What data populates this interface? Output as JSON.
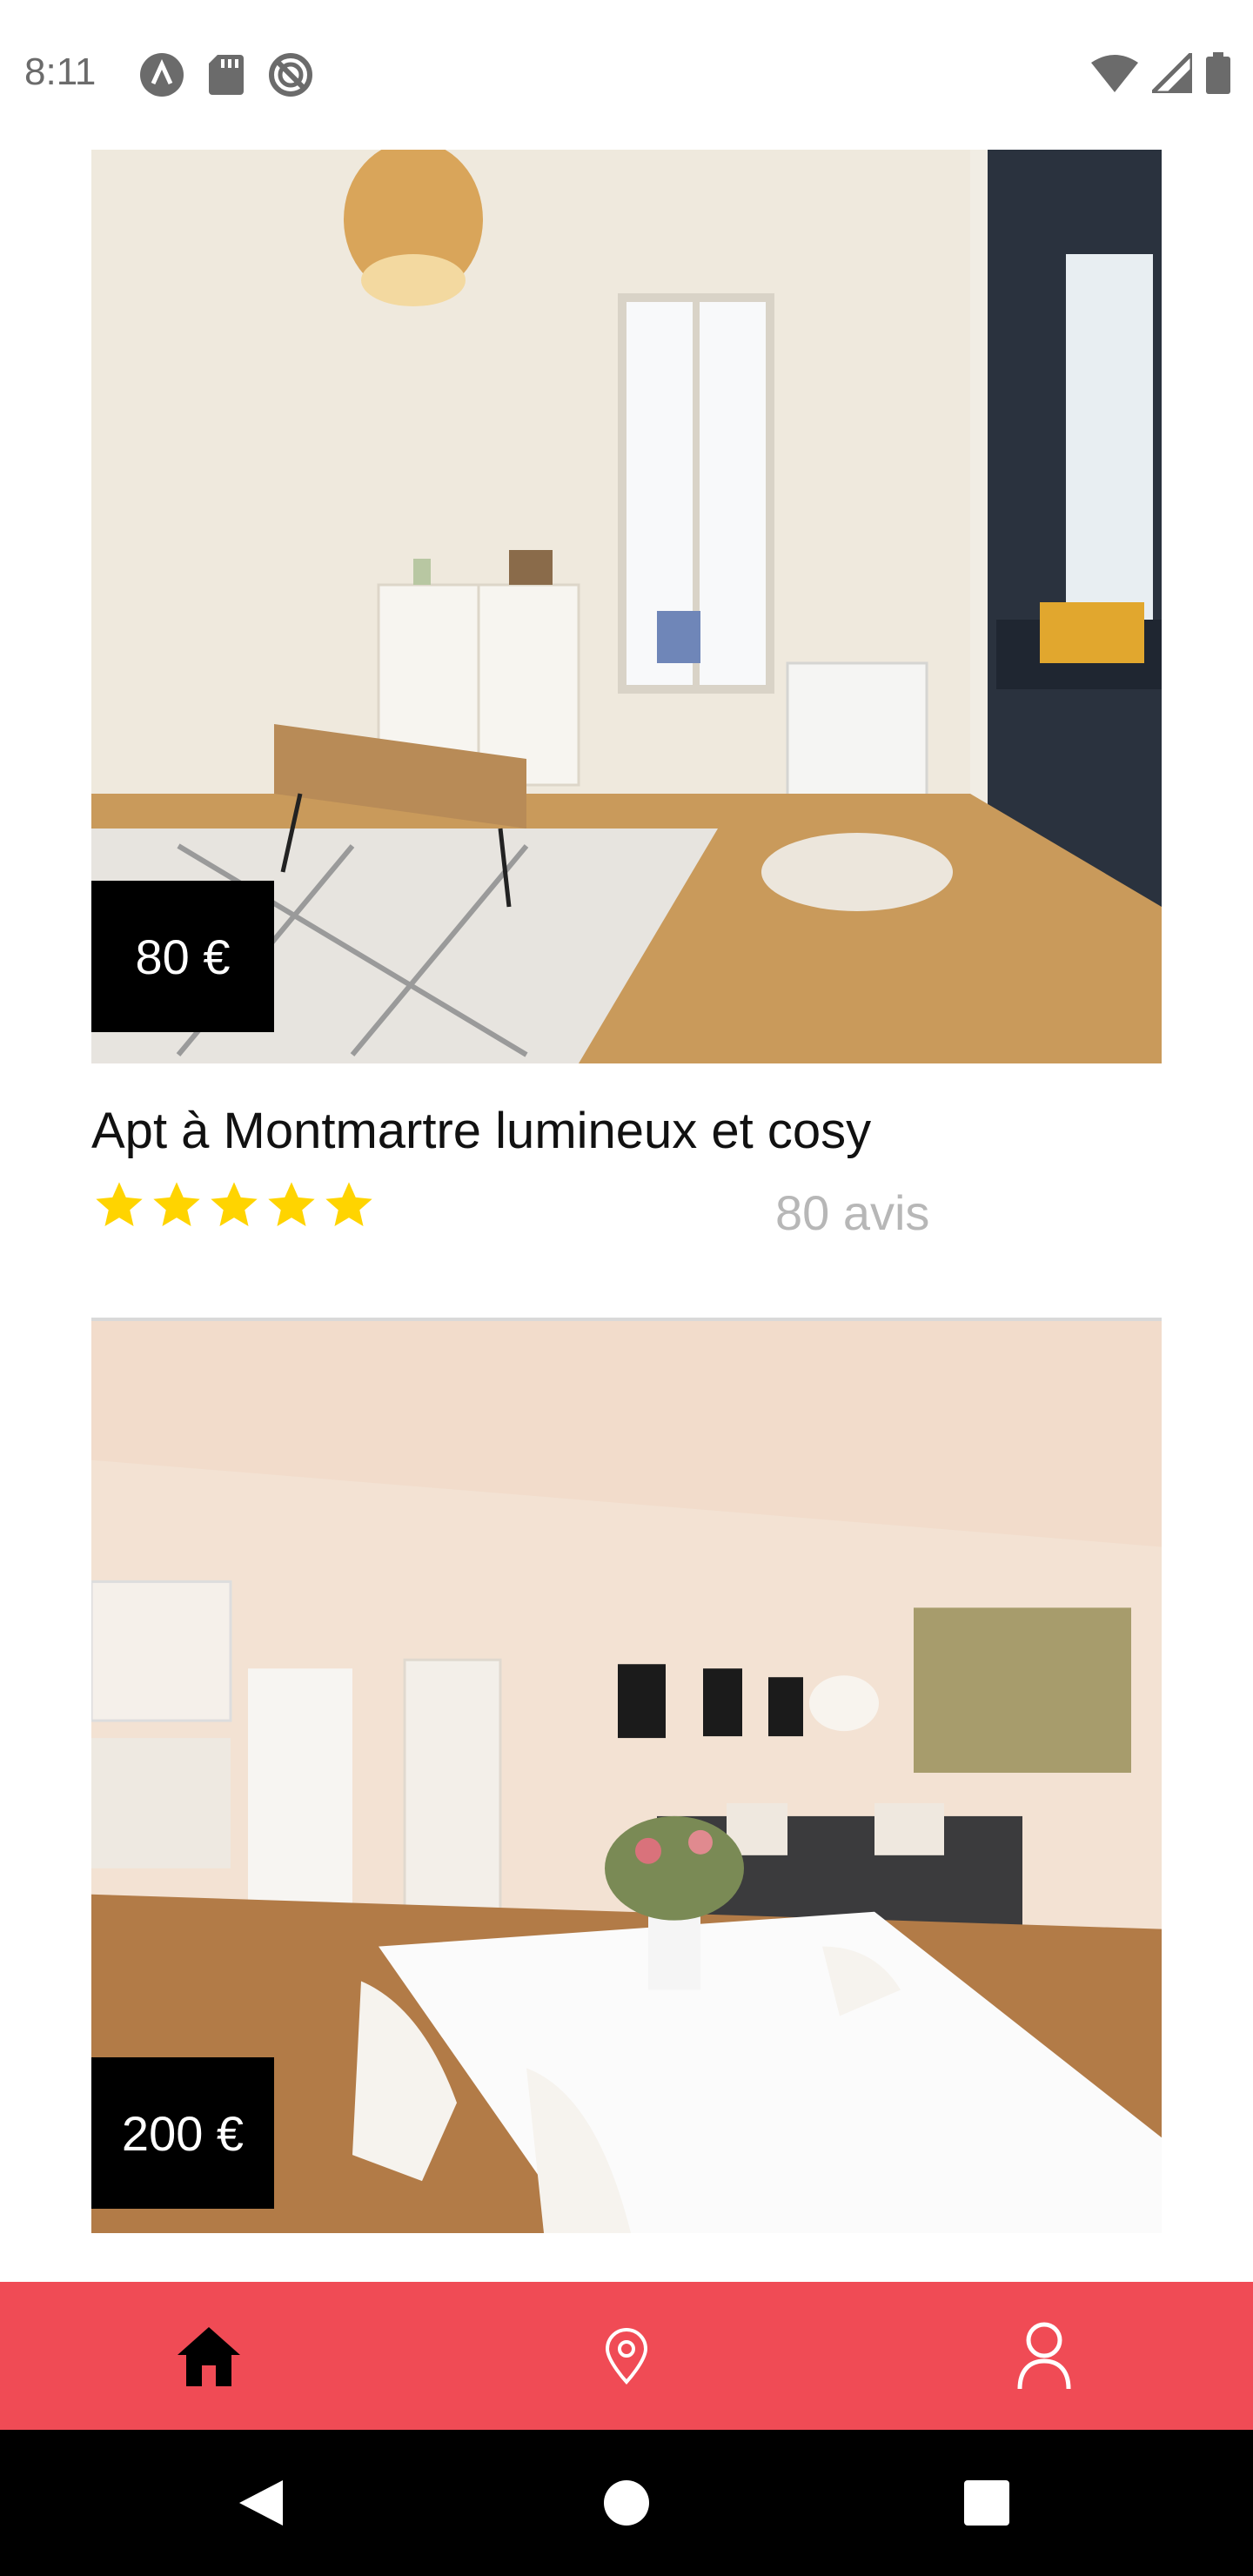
{
  "status_bar": {
    "time": "8:11",
    "left_icons": [
      "notification-a-icon",
      "sd-card-icon",
      "do-not-disturb-icon"
    ],
    "right_icons": [
      "wifi-icon",
      "cell-signal-icon",
      "battery-icon"
    ]
  },
  "listings": [
    {
      "price": "80 €",
      "title": "Apt à Montmartre lumineux et cosy",
      "rating": 5,
      "reviews": "80 avis",
      "image": "living-room-photo"
    },
    {
      "price": "200 €",
      "title": "",
      "image": "dining-living-room-photo"
    }
  ],
  "bottom_nav": {
    "items": [
      {
        "icon": "home-icon",
        "active": true
      },
      {
        "icon": "map-pin-icon",
        "active": false
      },
      {
        "icon": "user-icon",
        "active": false
      }
    ]
  },
  "colors": {
    "accent": "#f04b55",
    "star": "#ffd400",
    "price_bg": "#000000",
    "reviews_text": "#b7b7b7"
  },
  "system_nav": {
    "items": [
      "back-icon",
      "home-circle-icon",
      "recents-icon"
    ]
  }
}
